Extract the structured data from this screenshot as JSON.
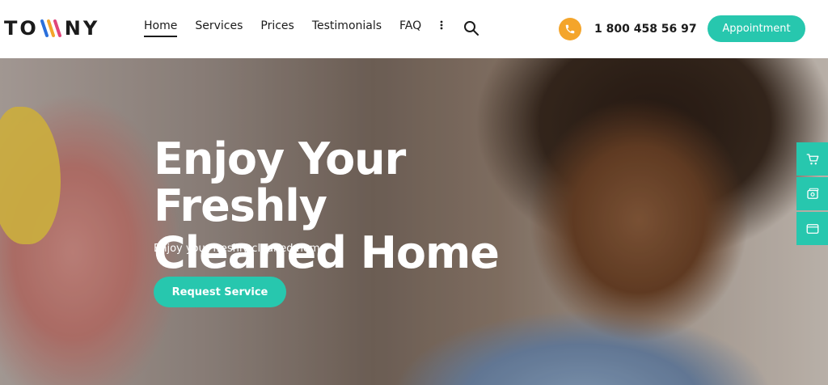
{
  "brand": {
    "name_part1": "TO",
    "name_part2": "NY",
    "logo_icon": "w-stripes-icon"
  },
  "nav": {
    "items": [
      {
        "label": "Home",
        "active": true
      },
      {
        "label": "Services",
        "active": false
      },
      {
        "label": "Prices",
        "active": false
      },
      {
        "label": "Testimonials",
        "active": false
      },
      {
        "label": "FAQ",
        "active": false
      }
    ],
    "more_icon": "more-vertical-icon"
  },
  "header": {
    "search_icon": "search-icon",
    "phone_icon": "phone-icon",
    "phone_number": "1 800 458 56 97",
    "appointment_label": "Appointment"
  },
  "hero": {
    "title_line1": "Enjoy Your Freshly",
    "title_line2": "Cleaned Home",
    "subtitle": "Enjoy your freshly cleaned home",
    "cta_label": "Request Service"
  },
  "side_tools": {
    "items": [
      "cart-icon",
      "gallery-icon",
      "window-icon"
    ]
  },
  "colors": {
    "accent": "#27c7ae",
    "phone_badge": "#f4a52b",
    "text_dark": "#1b1b1b"
  }
}
